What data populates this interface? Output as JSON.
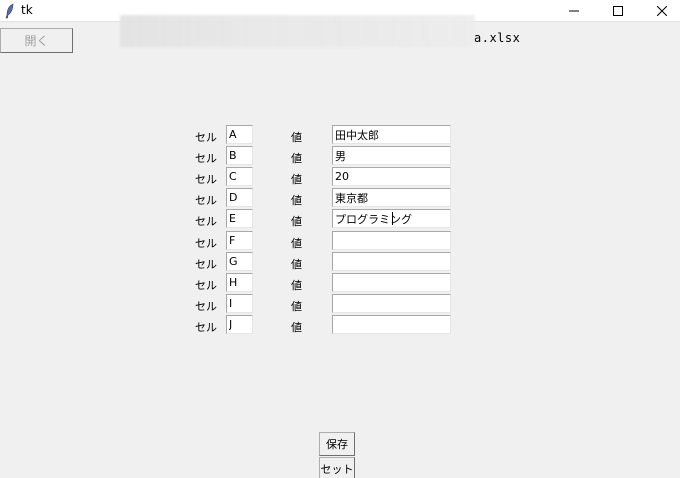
{
  "window": {
    "title": "tk",
    "minimize_icon": "minimize-icon",
    "maximize_icon": "maximize-icon",
    "close_icon": "close-icon"
  },
  "toolbar": {
    "open_label": "開く",
    "file_name": "a.xlsx"
  },
  "form": {
    "cell_label": "セル",
    "value_label": "値",
    "rows": [
      {
        "cell": "A",
        "value": "田中太郎"
      },
      {
        "cell": "B",
        "value": "男"
      },
      {
        "cell": "C",
        "value": "20"
      },
      {
        "cell": "D",
        "value": "東京都"
      },
      {
        "cell": "E",
        "value": "プログラミング"
      },
      {
        "cell": "F",
        "value": ""
      },
      {
        "cell": "G",
        "value": ""
      },
      {
        "cell": "H",
        "value": ""
      },
      {
        "cell": "I",
        "value": ""
      },
      {
        "cell": "J",
        "value": ""
      }
    ]
  },
  "actions": {
    "save_label": "保存",
    "set_label": "セット"
  }
}
